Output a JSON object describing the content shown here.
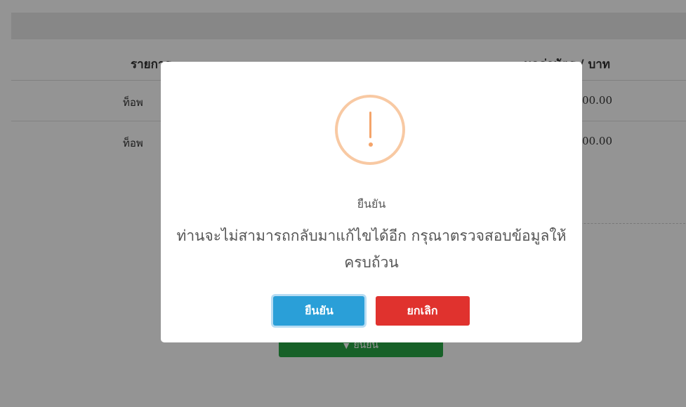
{
  "table": {
    "headers": {
      "item": "รายการ",
      "price": "มูลค่าบัตร / บาท"
    },
    "rows": [
      {
        "item": "ท็อพ",
        "price": "00.00"
      },
      {
        "item": "ท็อพ",
        "price": "00.00"
      }
    ]
  },
  "page_confirm_button": {
    "label": "ยืนยัน",
    "icon": "chevron-down-icon"
  },
  "dialog": {
    "icon": "warning-icon",
    "title": "ยืนยัน",
    "message": "ท่านจะไม่สามารถกลับมาแก้ไขได้อีก กรุณาตรวจสอบข้อมูลให้ครบถ้วน",
    "confirm_label": "ยืนยัน",
    "cancel_label": "ยกเลิก"
  },
  "colors": {
    "overlay": "#000000",
    "confirm_button": "#2a9fd8",
    "cancel_button": "#e0322e",
    "warning_icon": "#f4a46a",
    "page_confirm_button": "#28a745"
  }
}
